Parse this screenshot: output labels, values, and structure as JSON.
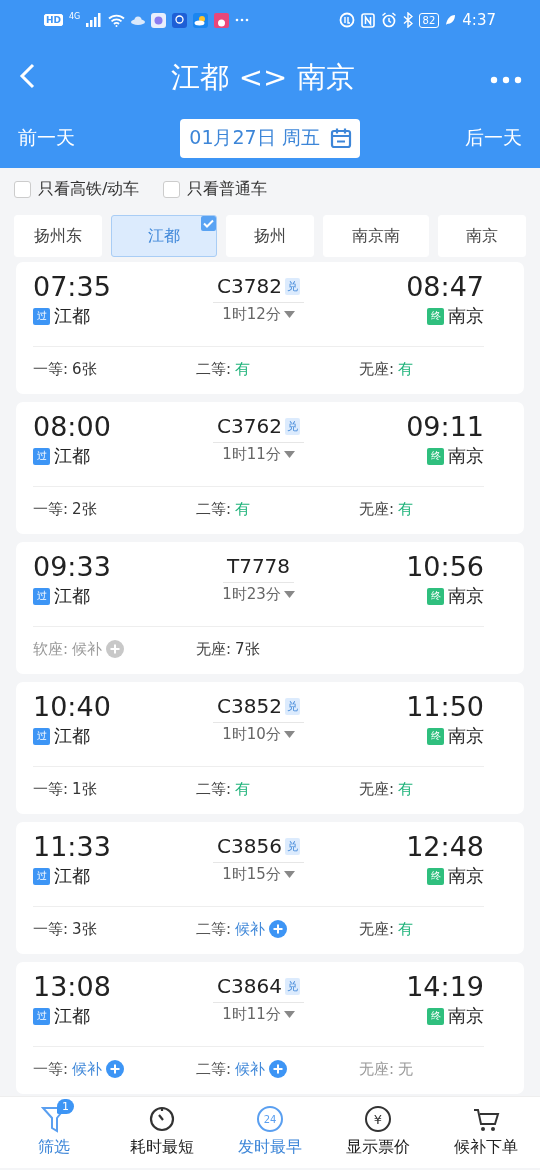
{
  "status_bar": {
    "left": [
      "HD",
      "4G"
    ],
    "battery": "82",
    "time": "4:37"
  },
  "header": {
    "title": "江都 <> 南京",
    "prev_day": "前一天",
    "date": "01月27日 周五",
    "next_day": "后一天"
  },
  "filters": [
    {
      "label": "只看高铁/动车",
      "checked": false
    },
    {
      "label": "只看普通车",
      "checked": false
    }
  ],
  "stations": [
    {
      "label": "扬州东",
      "selected": false
    },
    {
      "label": "江都",
      "selected": true
    },
    {
      "label": "扬州",
      "selected": false
    },
    {
      "label": "南京南",
      "selected": false
    },
    {
      "label": "南京",
      "selected": false
    }
  ],
  "trains": [
    {
      "depart": "07:35",
      "from_tag": "过",
      "from": "江都",
      "number": "C3782",
      "badge": "兑",
      "duration": "1时12分",
      "arrive": "08:47",
      "to_tag": "终",
      "to": "南京",
      "seats": [
        {
          "label": "一等:",
          "value": "6张",
          "kind": "count"
        },
        {
          "label": "二等:",
          "value": "有",
          "kind": "have"
        },
        {
          "label": "无座:",
          "value": "有",
          "kind": "have"
        }
      ]
    },
    {
      "depart": "08:00",
      "from_tag": "过",
      "from": "江都",
      "number": "C3762",
      "badge": "兑",
      "duration": "1时11分",
      "arrive": "09:11",
      "to_tag": "终",
      "to": "南京",
      "seats": [
        {
          "label": "一等:",
          "value": "2张",
          "kind": "count"
        },
        {
          "label": "二等:",
          "value": "有",
          "kind": "have"
        },
        {
          "label": "无座:",
          "value": "有",
          "kind": "have"
        }
      ]
    },
    {
      "depart": "09:33",
      "from_tag": "过",
      "from": "江都",
      "number": "T7778",
      "duration": "1时23分",
      "arrive": "10:56",
      "to_tag": "终",
      "to": "南京",
      "seats": [
        {
          "label": "软座:",
          "value": "候补",
          "kind": "waitlist_off"
        },
        {
          "label": "无座:",
          "value": "7张",
          "kind": "count"
        }
      ]
    },
    {
      "depart": "10:40",
      "from_tag": "过",
      "from": "江都",
      "number": "C3852",
      "badge": "兑",
      "duration": "1时10分",
      "arrive": "11:50",
      "to_tag": "终",
      "to": "南京",
      "seats": [
        {
          "label": "一等:",
          "value": "1张",
          "kind": "count"
        },
        {
          "label": "二等:",
          "value": "有",
          "kind": "have"
        },
        {
          "label": "无座:",
          "value": "有",
          "kind": "have"
        }
      ]
    },
    {
      "depart": "11:33",
      "from_tag": "过",
      "from": "江都",
      "number": "C3856",
      "badge": "兑",
      "duration": "1时15分",
      "arrive": "12:48",
      "to_tag": "终",
      "to": "南京",
      "seats": [
        {
          "label": "一等:",
          "value": "3张",
          "kind": "count"
        },
        {
          "label": "二等:",
          "value": "候补",
          "kind": "waitlist"
        },
        {
          "label": "无座:",
          "value": "有",
          "kind": "have"
        }
      ]
    },
    {
      "depart": "13:08",
      "from_tag": "过",
      "from": "江都",
      "number": "C3864",
      "badge": "兑",
      "duration": "1时11分",
      "arrive": "14:19",
      "to_tag": "终",
      "to": "南京",
      "seats": [
        {
          "label": "一等:",
          "value": "候补",
          "kind": "waitlist"
        },
        {
          "label": "二等:",
          "value": "候补",
          "kind": "waitlist"
        },
        {
          "label": "无座:",
          "value": "无",
          "kind": "none"
        }
      ]
    }
  ],
  "bottom_nav": [
    {
      "label": "筛选",
      "kind": "filter",
      "badge": "1",
      "selected": true
    },
    {
      "label": "耗时最短",
      "kind": "timer",
      "selected": false
    },
    {
      "label": "发时最早",
      "kind": "clock24",
      "icon_text": "24",
      "selected": true
    },
    {
      "label": "显示票价",
      "kind": "yen",
      "icon_text": "¥",
      "selected": false
    },
    {
      "label": "候补下单",
      "kind": "cart",
      "selected": false
    }
  ]
}
